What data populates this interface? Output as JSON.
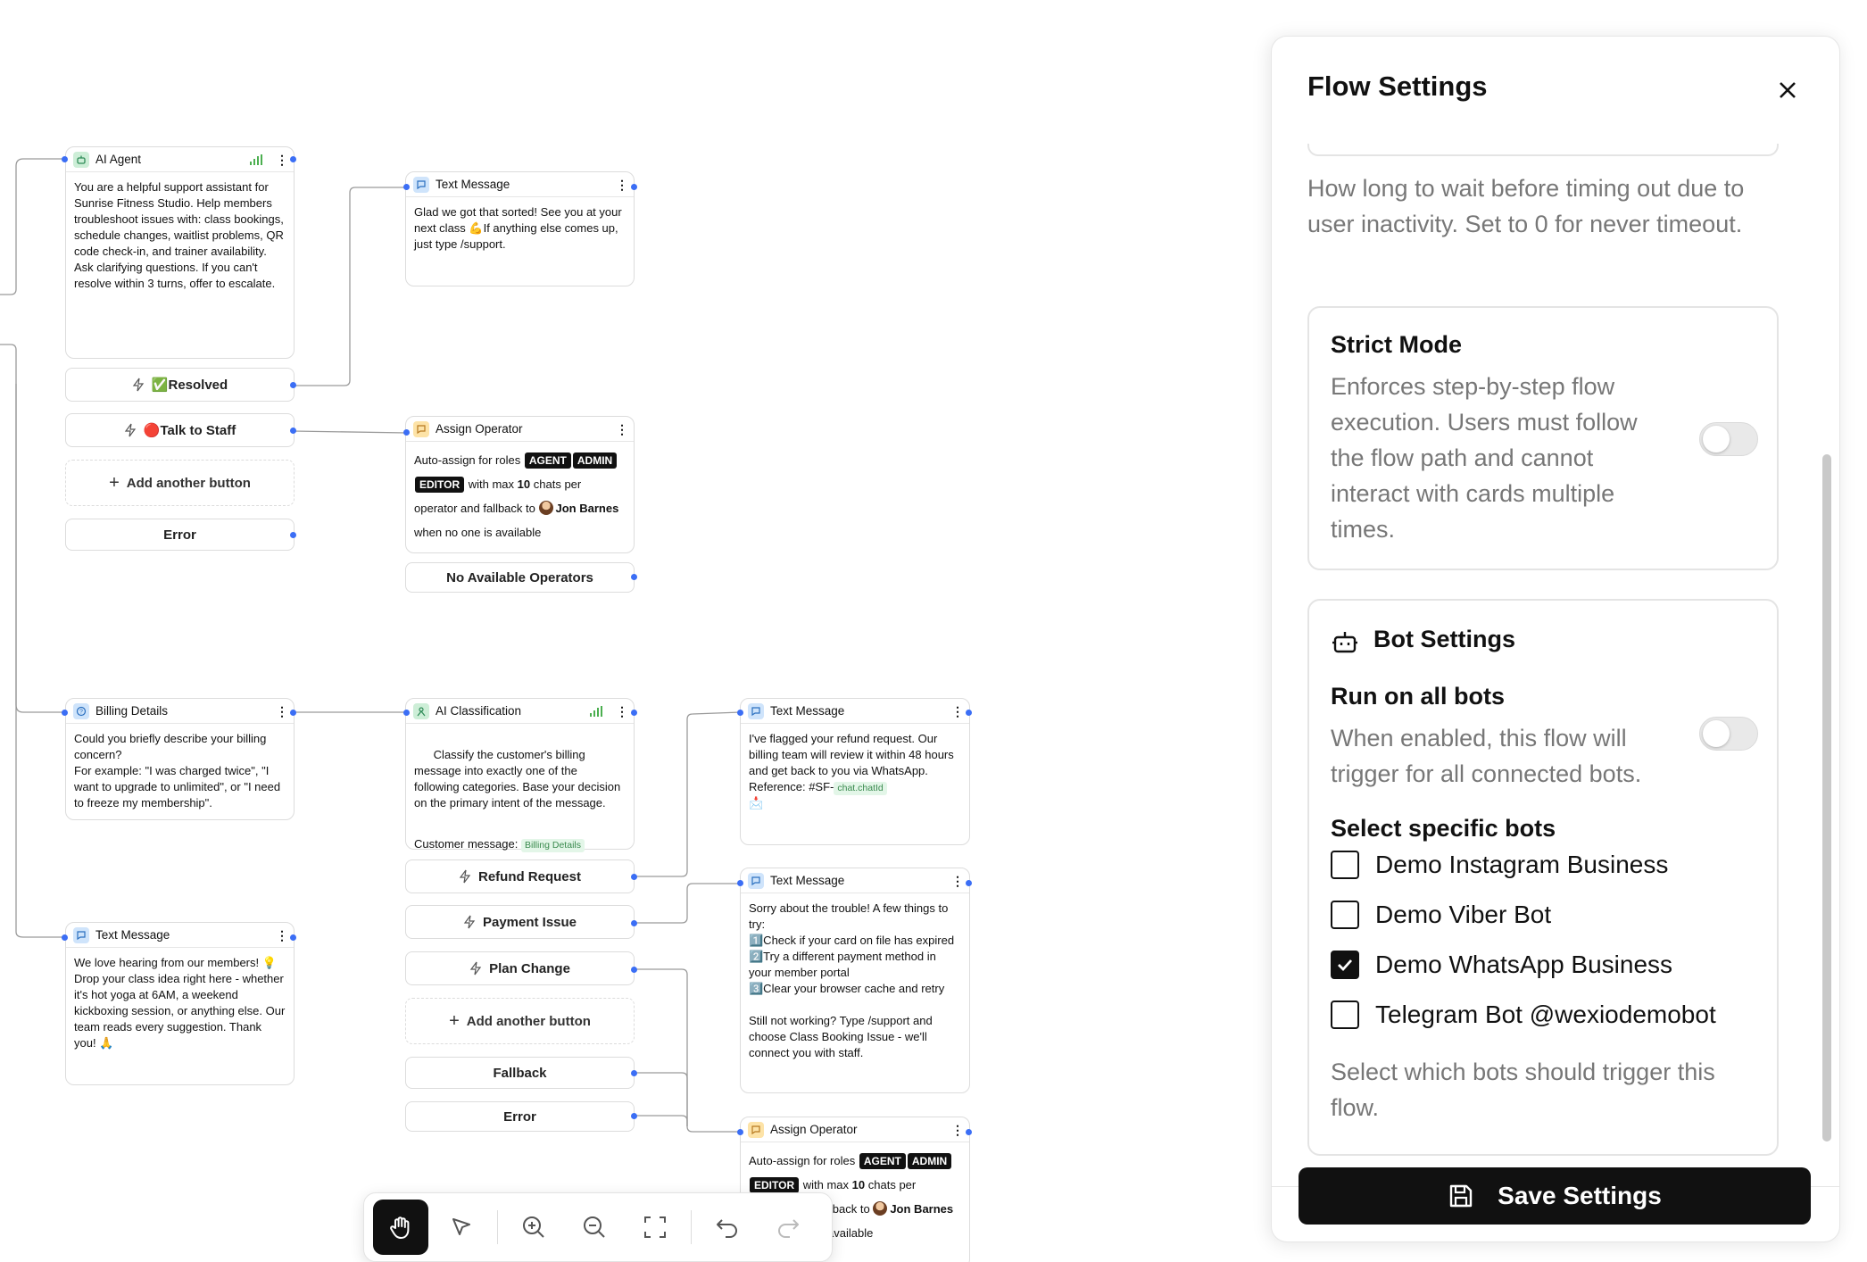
{
  "canvas": {
    "ai_agent": {
      "title": "AI Agent",
      "body": "You are a helpful support assistant for Sunrise Fitness Studio. Help members troubleshoot issues with: class bookings, schedule changes, waitlist problems, QR code check-in, and trainer availability. Ask clarifying questions. If you can't resolve within 3 turns, offer to escalate.",
      "buttons": [
        "✅Resolved",
        "🔴Talk to Staff"
      ],
      "add_button": "Add another button",
      "error": "Error"
    },
    "text_msg_1": {
      "title": "Text Message",
      "body": "Glad we got that sorted! See you at your next class 💪If anything else comes up, just type /support."
    },
    "assign_1": {
      "title": "Assign Operator",
      "line1": "Auto-assign for roles",
      "roles": [
        "AGENT",
        "ADMIN",
        "EDITOR"
      ],
      "with_max": "with max",
      "max_num": "10",
      "chats_per": "chats per",
      "operator_fallback": "operator and fallback to",
      "fallback_name": "Jon Barnes",
      "when_none": "when no one is available",
      "no_ops": "No Available Operators"
    },
    "billing": {
      "title": "Billing Details",
      "body": "Could you briefly describe your billing concern?\nFor example: \"I was charged twice\", \"I want to upgrade to unlimited\", or \"I need to freeze my membership\"."
    },
    "ai_class": {
      "title": "AI Classification",
      "body": "Classify the customer's billing message into exactly one of the following categories. Base your decision on the primary intent of the message.",
      "customer_label": "Customer message:",
      "customer_chip": "Billing Details",
      "buttons": [
        "Refund Request",
        "Payment Issue",
        "Plan Change"
      ],
      "add_button": "Add another button",
      "fallback": "Fallback",
      "error": "Error"
    },
    "text_msg_2": {
      "title": "Text Message",
      "body": "I've flagged your refund request. Our billing team will review it within 48 hours and get back to you via WhatsApp. Reference: #SF-",
      "chip": "chat.chatId",
      "tail": "📩"
    },
    "text_msg_3": {
      "title": "Text Message",
      "body": "Sorry about the trouble! A few things to try:\n1️⃣Check if your card on file has expired\n2️⃣Try a different payment method in your member portal\n3️⃣Clear your browser cache and retry\n\nStill not working? Type /support and choose Class Booking Issue - we'll connect you with staff."
    },
    "text_msg_4": {
      "title": "Text Message",
      "body": "We love hearing from our members! 💡 Drop your class idea right here - whether it's hot yoga at 6AM, a weekend kickboxing session, or anything else. Our team reads every suggestion. Thank you! 🙏"
    },
    "assign_2": {
      "title": "Assign Operator",
      "line1": "Auto-assign for roles",
      "roles": [
        "AGENT",
        "ADMIN",
        "EDITOR"
      ],
      "with_max": "with max",
      "max_num": "10",
      "chats_per": "chats per",
      "fallback_partial": "llback to",
      "fallback_name": "Jon Barnes",
      "available_partial": "available"
    }
  },
  "toolbar": {
    "tools": [
      "hand-icon",
      "pointer-icon",
      "zoom-in-icon",
      "zoom-out-icon",
      "fit-screen-icon",
      "undo-icon",
      "redo-icon"
    ],
    "active": "hand-icon"
  },
  "panel": {
    "title": "Flow Settings",
    "timeout_help": "How long to wait before timing out due to user inactivity. Set to 0 for never timeout.",
    "strict_mode": {
      "title": "Strict Mode",
      "description": "Enforces step-by-step flow execution. Users must follow the flow path and cannot interact with cards multiple times.",
      "enabled": false
    },
    "bot_settings": {
      "title": "Bot Settings",
      "run_all_title": "Run on all bots",
      "run_all_desc": "When enabled, this flow will trigger for all connected bots.",
      "run_all_enabled": false,
      "select_title": "Select specific bots",
      "bots": [
        {
          "name": "Demo Instagram Business",
          "checked": false
        },
        {
          "name": "Demo Viber Bot",
          "checked": false
        },
        {
          "name": "Demo WhatsApp Business",
          "checked": true
        },
        {
          "name": "Telegram Bot @wexiodemobot",
          "checked": false
        }
      ],
      "helper": "Select which bots should trigger this flow."
    },
    "save_label": "Save Settings"
  },
  "colors": {
    "accent_dot": "#3b6ef5",
    "dark": "#111111"
  }
}
